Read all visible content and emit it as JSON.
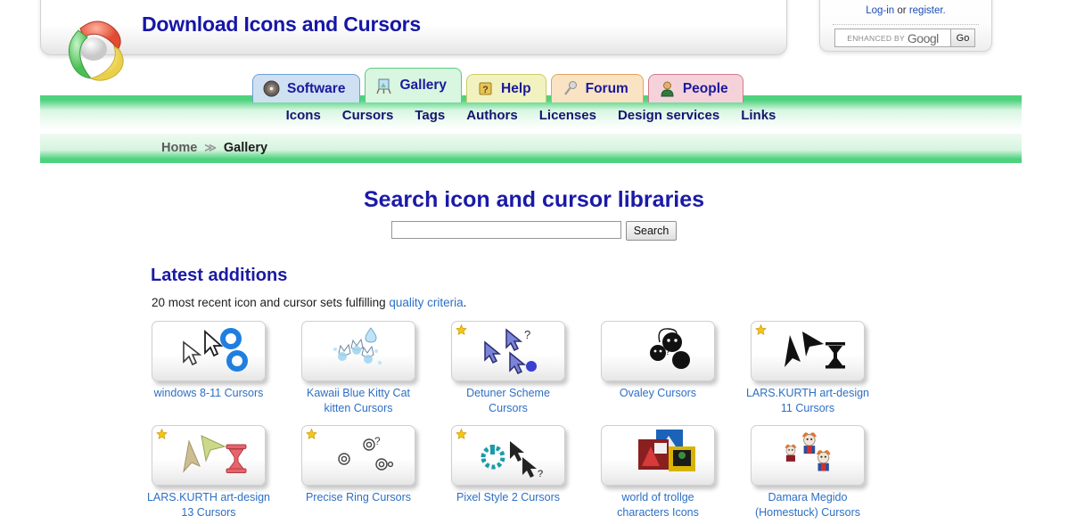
{
  "header": {
    "site_title": "Download Icons and Cursors",
    "logo_icon": "tricolor-ring-logo"
  },
  "login": {
    "login_label": "Log-in",
    "or_text": " or ",
    "register_label": "register.",
    "google_enhanced_text": "Enhanced by",
    "google_wordmark": "Googl",
    "go_label": "Go"
  },
  "tabs": [
    {
      "label": "Software",
      "icon": "cd-disc-icon",
      "active": false,
      "bg": "#cfe0f2",
      "border": "#6f9fd0"
    },
    {
      "label": "Gallery",
      "icon": "easel-icon",
      "active": true,
      "bg": "#d9f6e0",
      "border": "#5bc97f"
    },
    {
      "label": "Help",
      "icon": "help-book-icon",
      "active": false,
      "bg": "#f2f2c0",
      "border": "#cccc66"
    },
    {
      "label": "Forum",
      "icon": "microphone-icon",
      "active": false,
      "bg": "#fae3c3",
      "border": "#e0a55c"
    },
    {
      "label": "People",
      "icon": "person-icon",
      "active": false,
      "bg": "#f5d2da",
      "border": "#d2798e"
    }
  ],
  "subnav": [
    "Icons",
    "Cursors",
    "Tags",
    "Authors",
    "Licenses",
    "Design services",
    "Links"
  ],
  "breadcrumb": {
    "home": "Home",
    "separator": "≫",
    "current": "Gallery"
  },
  "search": {
    "heading": "Search icon and cursor libraries",
    "input_value": "",
    "input_placeholder": "",
    "button_label": "Search"
  },
  "latest": {
    "title": "Latest additions",
    "subtitle_before": "20 most recent icon and cursor sets fulfilling ",
    "subtitle_link": "quality criteria",
    "subtitle_after": "."
  },
  "gallery_items": [
    {
      "label": "windows 8-11 Cursors",
      "starred": false,
      "art": "blue-ring-cursors"
    },
    {
      "label": "Kawaii Blue Kitty Cat kitten Cursors",
      "starred": false,
      "art": "kawaii-cats"
    },
    {
      "label": "Detuner Scheme Cursors",
      "starred": true,
      "art": "blue-arrow-cursors"
    },
    {
      "label": "Ovaley Cursors",
      "starred": false,
      "art": "black-bomb-faces"
    },
    {
      "label": "LARS.KURTH art-design 11 Cursors",
      "starred": true,
      "art": "black-arrows-hourglass"
    },
    {
      "label": "LARS.KURTH art-design 13 Cursors",
      "starred": true,
      "art": "tan-arrows-red-hourglass"
    },
    {
      "label": "Precise Ring Cursors",
      "starred": true,
      "art": "precise-rings"
    },
    {
      "label": "Pixel Style 2 Cursors",
      "starred": true,
      "art": "pixel-teal-ring"
    },
    {
      "label": "world of trollge characters Icons",
      "starred": false,
      "art": "trollge-thumbnails"
    },
    {
      "label": "Damara Megido (Homestuck) Cursors",
      "starred": false,
      "art": "damara-megido-heads"
    }
  ],
  "colors": {
    "title_blue": "#1616a8",
    "link_blue": "#2d6fc4",
    "nav_navy": "#151570",
    "accent_green": "#4fd27e"
  }
}
